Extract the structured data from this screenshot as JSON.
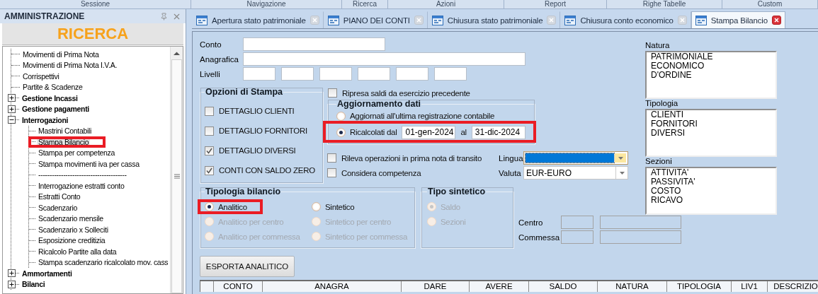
{
  "menu_bar": [
    "Sessione",
    "Navigazione",
    "Ricerca",
    "Azioni",
    "Report",
    "Righe Tabelle",
    "Custom"
  ],
  "side_panel": {
    "title": "AMMINISTRAZIONE",
    "search_title": "RICERCA",
    "tree": [
      {
        "label": "Movimenti di Prima Nota",
        "selected": false
      },
      {
        "label": "Movimenti di Prima Nota I.V.A.",
        "selected": false
      },
      {
        "label": "Corrispettivi",
        "selected": false
      },
      {
        "label": "Partite & Scadenze",
        "selected": false
      },
      {
        "label": "Gestione Incassi",
        "selected": false,
        "expanded": false
      },
      {
        "label": "Gestione pagamenti",
        "selected": false,
        "expanded": false
      },
      {
        "label": "Interrogazioni",
        "selected": false,
        "expanded": true,
        "children": [
          {
            "label": "Mastrini Contabili",
            "selected": false
          },
          {
            "label": "Stampa Bilancio",
            "selected": true,
            "highlighted": true
          },
          {
            "label": "Stampa per competenza",
            "selected": false
          },
          {
            "label": "Stampa movimenti iva per cassa",
            "selected": false
          },
          {
            "label": "---------------------------------------",
            "selected": false
          },
          {
            "label": "Interrogazione estratti conto",
            "selected": false
          },
          {
            "label": "Estratti Conto",
            "selected": false
          },
          {
            "label": "Scadenzario",
            "selected": false
          },
          {
            "label": "Scadenzario mensile",
            "selected": false
          },
          {
            "label": "Scadenzario x Solleciti",
            "selected": false
          },
          {
            "label": "Esposizione creditizia",
            "selected": false
          },
          {
            "label": "Ricalcolo Partite alla data",
            "selected": false
          },
          {
            "label": "Stampa scadenzario ricalcolato mov. cass",
            "selected": false
          }
        ]
      },
      {
        "label": "Ammortamenti",
        "selected": false,
        "expanded": false
      },
      {
        "label": "Bilanci",
        "selected": false,
        "expanded": false
      }
    ]
  },
  "tabs": [
    {
      "label": "Apertura stato patrimoniale",
      "selected": false
    },
    {
      "label": "PIANO DEI CONTI",
      "selected": false
    },
    {
      "label": "Chiusura stato patrimoniale",
      "selected": false
    },
    {
      "label": "Chiusura conto economico",
      "selected": false
    },
    {
      "label": "Stampa Bilancio",
      "selected": true
    }
  ],
  "form": {
    "fields": [
      {
        "label": "Conto",
        "kind": "short"
      },
      {
        "label": "Anagrafica",
        "kind": "long"
      },
      {
        "label": "Livelli",
        "kind": "levels"
      }
    ],
    "print_options": {
      "title": "Opzioni di Stampa",
      "items": [
        {
          "label": "DETTAGLIO CLIENTI",
          "checked": false
        },
        {
          "label": "DETTAGLIO FORNITORI",
          "checked": false
        },
        {
          "label": "DETTAGLIO DIVERSI",
          "checked": true
        },
        {
          "label": "CONTI CON SALDO ZERO",
          "checked": true
        }
      ]
    },
    "carry_over": {
      "label": "Ripresa saldi da esercizio precedente",
      "checked": false
    },
    "update": {
      "title": "Aggiornamento dati",
      "options": [
        {
          "label": "Aggiornati all'ultima registrazione contabile",
          "selected": false
        },
        {
          "label": "Ricalcolati dal",
          "selected": true,
          "highlighted": true,
          "from": "01-gen-2024",
          "to_label": "al",
          "to": "31-dic-2024"
        }
      ]
    },
    "extra_checks": [
      {
        "label": "Rileva operazioni in prima nota di transito",
        "checked": false
      },
      {
        "label": "Considera competenza",
        "checked": false
      }
    ],
    "lingua": {
      "label": "Lingua",
      "focused": true
    },
    "valuta": {
      "label": "Valuta",
      "value": "EUR-EURO"
    },
    "balance_type": {
      "title": "Tipologia bilancio",
      "columns": [
        [
          {
            "label": "Analitico",
            "selected": true,
            "disabled": false,
            "highlighted": true
          },
          {
            "label": "Analitico per centro",
            "selected": false,
            "disabled": true
          },
          {
            "label": "Analitico per commessa",
            "selected": false,
            "disabled": true
          }
        ],
        [
          {
            "label": "Sintetico",
            "selected": false,
            "disabled": false
          },
          {
            "label": "Sintetico per centro",
            "selected": false,
            "disabled": true
          },
          {
            "label": "Sintetico per commessa",
            "selected": false,
            "disabled": true
          }
        ]
      ]
    },
    "summary_type": {
      "title": "Tipo sintetico",
      "options": [
        {
          "label": "Saldo",
          "selected": true,
          "disabled": true
        },
        {
          "label": "Sezioni",
          "selected": false,
          "disabled": true
        }
      ]
    },
    "cost_fields": [
      {
        "label": "Centro"
      },
      {
        "label": "Commessa"
      }
    ],
    "export_button": "ESPORTA ANALITICO",
    "lists": [
      {
        "label": "Natura",
        "items": [
          "PATRIMONIALE",
          "ECONOMICO",
          "D'ORDINE"
        ]
      },
      {
        "label": "Tipologia",
        "items": [
          "CLIENTI",
          "FORNITORI",
          "DIVERSI"
        ]
      },
      {
        "label": "Sezioni",
        "items": [
          "ATTIVITA'",
          "PASSIVITA'",
          "COSTO",
          "RICAVO"
        ]
      }
    ]
  },
  "table": {
    "columns": [
      "CONTO",
      "ANAGRA",
      "DARE",
      "AVERE",
      "SALDO",
      "NATURA",
      "TIPOLOGIA",
      "LIV1",
      "DESCRIZIO"
    ]
  }
}
